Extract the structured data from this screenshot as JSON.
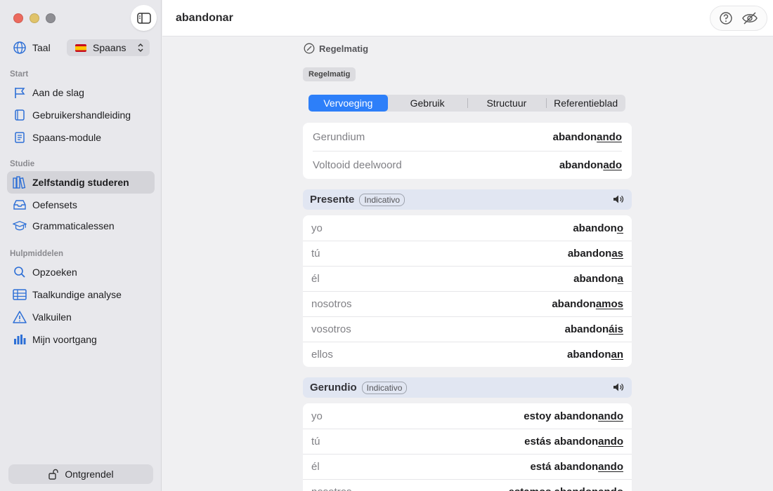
{
  "app": {
    "title": "abandonar"
  },
  "sidebar": {
    "language_label": "Taal",
    "language_value": "Spaans",
    "sections": [
      {
        "label": "Start",
        "items": [
          {
            "label": "Aan de slag",
            "icon": "flag-icon"
          },
          {
            "label": "Gebruikershandleiding",
            "icon": "book-icon"
          },
          {
            "label": "Spaans-module",
            "icon": "notebook-icon"
          }
        ]
      },
      {
        "label": "Studie",
        "items": [
          {
            "label": "Zelfstandig studeren",
            "icon": "books-icon",
            "active": true
          },
          {
            "label": "Oefensets",
            "icon": "tray-icon"
          },
          {
            "label": "Grammaticalessen",
            "icon": "graduation-cap-icon"
          }
        ]
      },
      {
        "label": "Hulpmiddelen",
        "items": [
          {
            "label": "Opzoeken",
            "icon": "magnifier-icon"
          },
          {
            "label": "Taalkundige analyse",
            "icon": "table-icon"
          },
          {
            "label": "Valkuilen",
            "icon": "warning-icon"
          },
          {
            "label": "Mijn voortgang",
            "icon": "bar-chart-icon"
          }
        ]
      }
    ],
    "unlock_label": "Ontgrendel"
  },
  "colors": {
    "accent": "#2d7ff9",
    "tense_header": "#e1e6f2",
    "sidebar_icon": "#2d6fd6"
  },
  "verb": {
    "type_heading": "Regelmatig",
    "type_chip": "Regelmatig",
    "tabs": [
      "Vervoeging",
      "Gebruik",
      "Structuur",
      "Referentieblad"
    ],
    "active_tab": 0,
    "forms": [
      {
        "label": "Gerundium",
        "stem": "abandon",
        "ending": "ando"
      },
      {
        "label": "Voltooid deelwoord",
        "stem": "abandon",
        "ending": "ado"
      }
    ],
    "tenses": [
      {
        "name": "Presente",
        "mood": "Indicativo",
        "rows": [
          {
            "pronoun": "yo",
            "prefix": "",
            "stem": "abandon",
            "ending": "o"
          },
          {
            "pronoun": "tú",
            "prefix": "",
            "stem": "abandon",
            "ending": "as"
          },
          {
            "pronoun": "él",
            "prefix": "",
            "stem": "abandon",
            "ending": "a"
          },
          {
            "pronoun": "nosotros",
            "prefix": "",
            "stem": "abandon",
            "ending": "amos"
          },
          {
            "pronoun": "vosotros",
            "prefix": "",
            "stem": "abandon",
            "ending": "áis"
          },
          {
            "pronoun": "ellos",
            "prefix": "",
            "stem": "abandon",
            "ending": "an"
          }
        ]
      },
      {
        "name": "Gerundio",
        "mood": "Indicativo",
        "rows": [
          {
            "pronoun": "yo",
            "prefix": "estoy ",
            "stem": "abandon",
            "ending": "ando"
          },
          {
            "pronoun": "tú",
            "prefix": "estás ",
            "stem": "abandon",
            "ending": "ando"
          },
          {
            "pronoun": "él",
            "prefix": "está ",
            "stem": "abandon",
            "ending": "ando"
          },
          {
            "pronoun": "nosotros",
            "prefix": "estamos ",
            "stem": "abandon",
            "ending": "ando"
          }
        ]
      }
    ]
  }
}
